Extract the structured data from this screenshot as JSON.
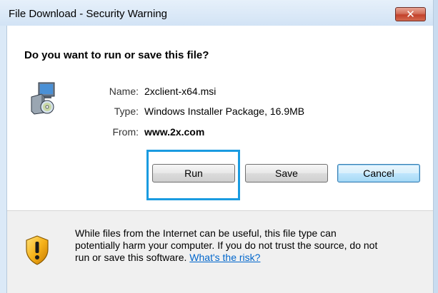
{
  "window": {
    "title": "File Download - Security Warning",
    "close_glyph": "✕",
    "accent_color": "#1a9be0"
  },
  "dialog": {
    "heading": "Do you want to run or save this file?",
    "file_icon": "installer-package-icon",
    "fields": {
      "name_label": "Name:",
      "name_value": "2xclient-x64.msi",
      "type_label": "Type:",
      "type_value": "Windows Installer Package, 16.9MB",
      "from_label": "From:",
      "from_value": "www.2x.com"
    },
    "buttons": {
      "run": "Run",
      "save": "Save",
      "cancel": "Cancel"
    }
  },
  "warning": {
    "icon": "shield-warning-icon",
    "line1": "While files from the Internet can be useful, this file type can",
    "line2": "potentially harm your computer. If you do not trust the source, do not",
    "line3": "run or save this software.",
    "link": "What's the risk?"
  }
}
